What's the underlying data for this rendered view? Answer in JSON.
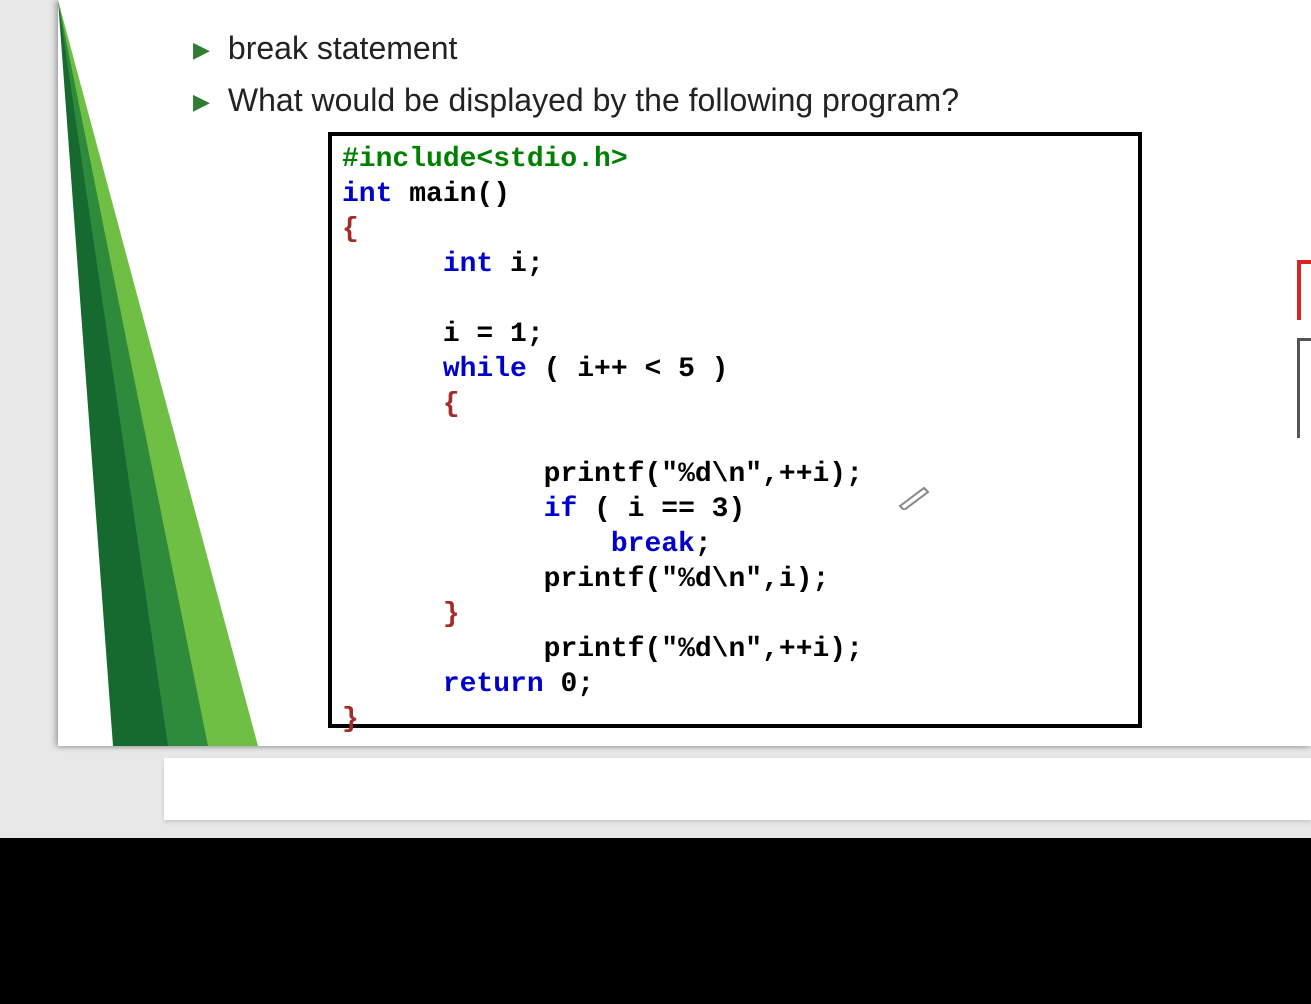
{
  "slide": {
    "bullets": [
      "break statement",
      "What would be displayed by the following program?"
    ],
    "code": {
      "line1_include": "#include<stdio.h>",
      "line2_int": "int",
      "line2_rest": " main()",
      "line3_brace": "{",
      "line4_indent": "      ",
      "line4_int": "int",
      "line4_rest": " i;",
      "blank1": " ",
      "line5": "      i = 1;",
      "line6_indent": "      ",
      "line6_while": "while",
      "line6_rest": " ( i++ < 5 )",
      "line7": "      {",
      "blank2": " ",
      "line8_indent": "            ",
      "line8_printf": "printf",
      "line8_rest": "(\"%d\\n\",++i);",
      "line9_indent": "            ",
      "line9_if": "if",
      "line9_rest": " ( i == 3)",
      "line10_indent": "                ",
      "line10_break": "break",
      "line10_semi": ";",
      "line11_indent": "            ",
      "line11_printf": "printf",
      "line11_rest": "(\"%d\\n\",i);",
      "line12": "      }",
      "line13_indent": "            ",
      "line13_printf": "printf",
      "line13_rest": "(\"%d\\n\",++i);",
      "line14_indent": "      ",
      "line14_return": "return",
      "line14_rest": " 0;",
      "line15_brace": "}"
    }
  },
  "colors": {
    "accent_green": "#2e7d32",
    "wedge_dark": "#166a2f",
    "wedge_light": "#6fbf44"
  }
}
